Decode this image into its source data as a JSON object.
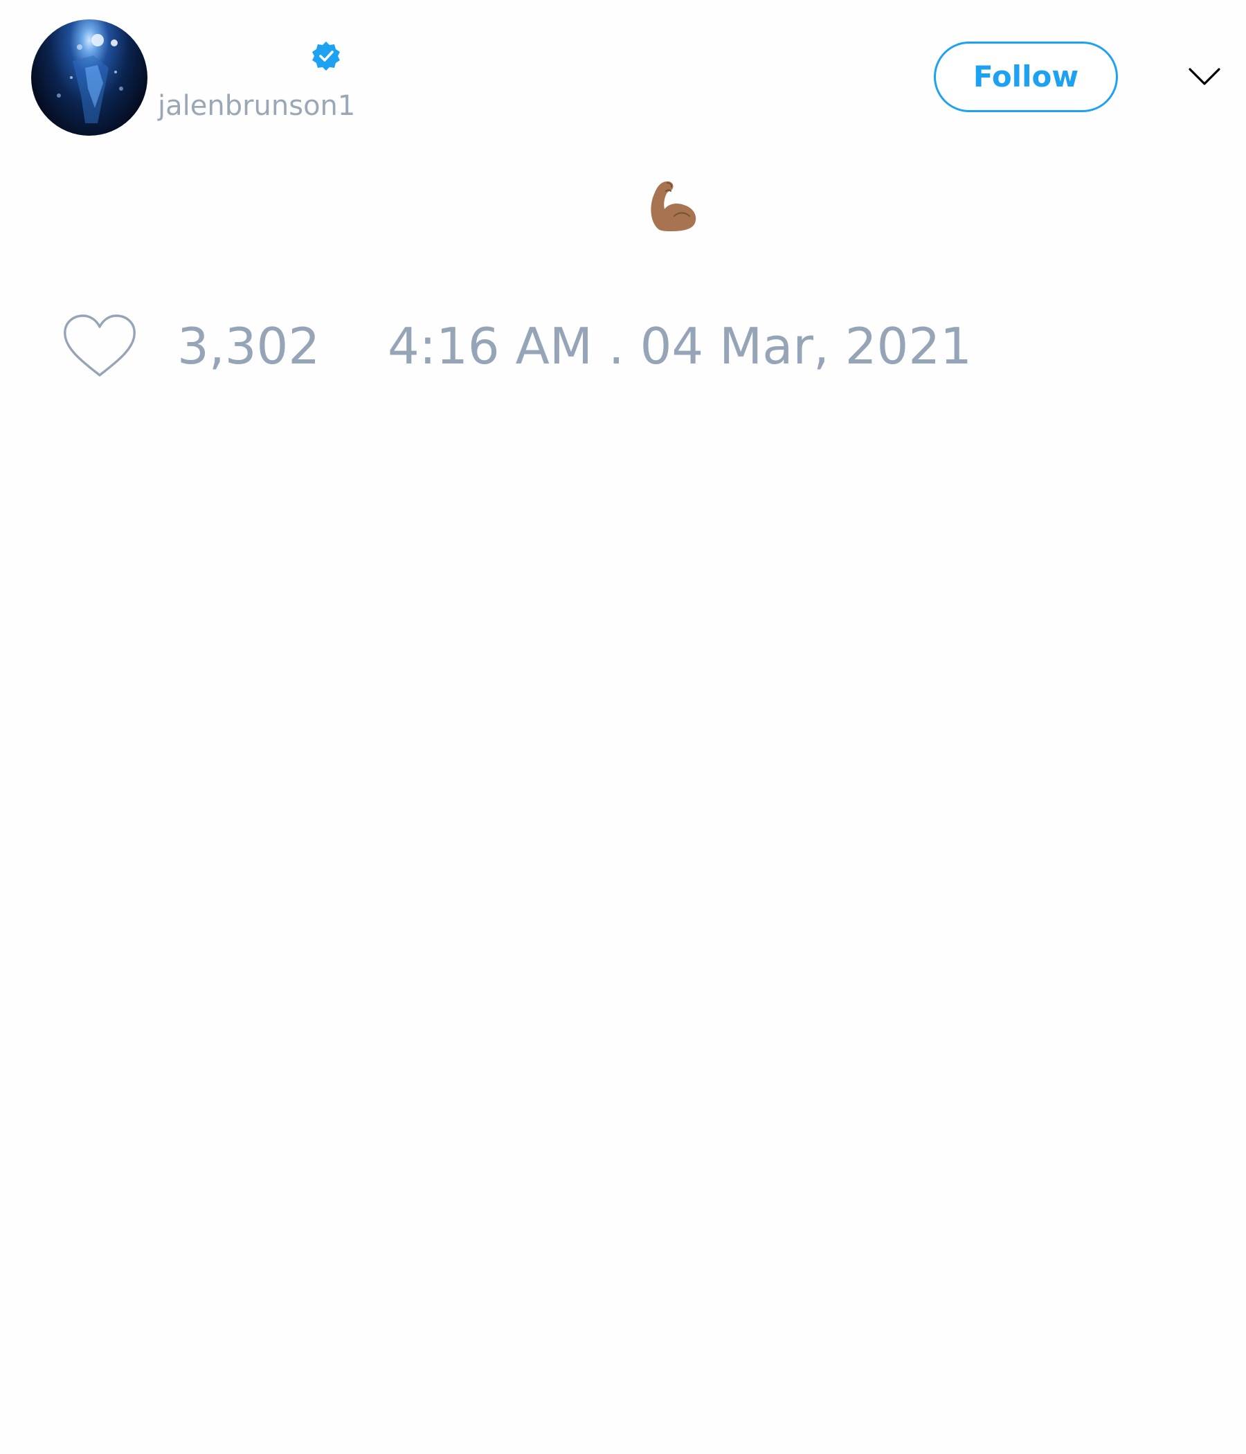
{
  "tweet": {
    "handle": "jalenbrunson1",
    "verified": true,
    "follow_label": "Follow",
    "content_emoji": "💪🏽",
    "likes": "3,302",
    "timestamp": "4:16 AM . 04 Mar, 2021"
  },
  "icons": {
    "avatar": "profile-avatar",
    "verified": "verified-badge-icon",
    "menu": "chevron-down-icon",
    "like": "heart-icon",
    "emoji": "flexed-biceps-emoji"
  },
  "colors": {
    "accent": "#1da1f2",
    "muted_text": "#95a4b6",
    "chevron": "#000000",
    "heart_outline": "#95a4b6",
    "emoji_skin": "#a87350"
  }
}
